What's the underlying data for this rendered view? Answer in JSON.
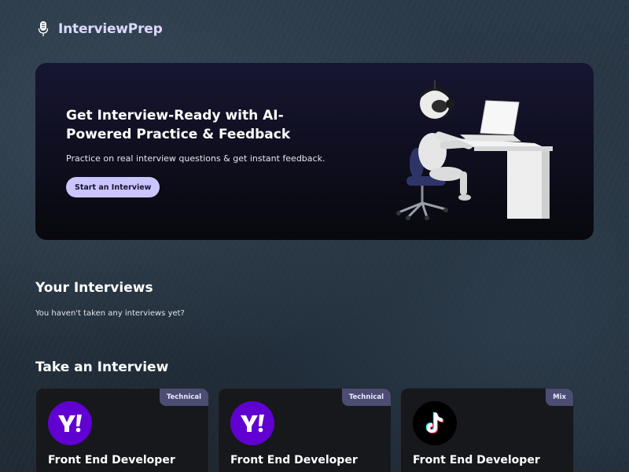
{
  "header": {
    "brand": "InterviewPrep",
    "logo_icon": "microphone-icon"
  },
  "hero": {
    "title": "Get Interview-Ready with AI-Powered Practice & Feedback",
    "subtitle": "Practice on real interview questions & get instant feedback.",
    "cta_label": "Start an Interview",
    "illustration": "robot-at-desk-image"
  },
  "your_interviews": {
    "title": "Your Interviews",
    "empty_message": "You haven't taken any interviews yet?"
  },
  "take_interview": {
    "title": "Take an Interview",
    "cards": [
      {
        "badge": "Technical",
        "role": "Front End Developer",
        "logo": "yahoo-logo"
      },
      {
        "badge": "Technical",
        "role": "Front End Developer",
        "logo": "yahoo-logo"
      },
      {
        "badge": "Mix",
        "role": "Front End Developer",
        "logo": "tiktok-logo"
      }
    ]
  },
  "colors": {
    "brand_text": "#dcd9ff",
    "cta_background": "#cac5ff",
    "badge_background": "#4b4d72",
    "card_background": "#17181c",
    "yahoo_purple": "#6001d2"
  }
}
